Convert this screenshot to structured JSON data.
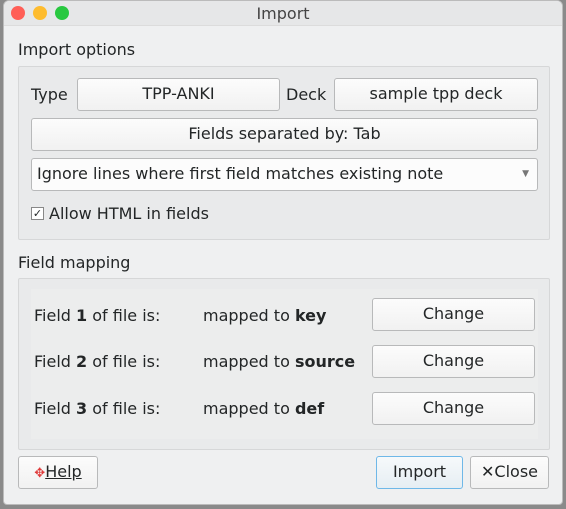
{
  "window": {
    "title": "Import",
    "colors": {
      "close": "#ff5f57",
      "minimize": "#febc2e",
      "maximize": "#28c840"
    }
  },
  "import_options": {
    "heading": "Import options",
    "type_label": "Type",
    "type_value": "TPP-ANKI",
    "deck_label": "Deck",
    "deck_value": "sample tpp deck",
    "separator_button": "Fields separated by: Tab",
    "duplicate_mode": "Ignore lines where first field matches existing note",
    "allow_html_label": "Allow HTML in fields",
    "allow_html_checked": true
  },
  "field_mapping": {
    "heading": "Field mapping",
    "rows": [
      {
        "prefix": "Field ",
        "num": "1",
        "suffix": " of file is:",
        "mapped_prefix": "mapped to ",
        "target": "key",
        "button": "Change"
      },
      {
        "prefix": "Field ",
        "num": "2",
        "suffix": " of file is:",
        "mapped_prefix": "mapped to ",
        "target": "source",
        "button": "Change"
      },
      {
        "prefix": "Field ",
        "num": "3",
        "suffix": " of file is:",
        "mapped_prefix": "mapped to ",
        "target": "def",
        "button": "Change"
      }
    ]
  },
  "buttons": {
    "help": "Help",
    "import": "Import",
    "close": "Close"
  }
}
